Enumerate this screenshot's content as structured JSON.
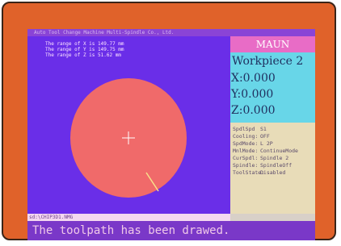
{
  "window": {
    "title": "Auto Tool Change Machine Multi-Spindle Co., Ltd."
  },
  "ranges": [
    "The range of X is 149.77 mm",
    "The range of Y is 149.75 mm",
    "The range of Z is 51.62 mm"
  ],
  "side": {
    "header": "MAUN",
    "workpiece": "Workpiece 2",
    "coords": {
      "x": "X:0.000",
      "y": "Y:0.000",
      "z": "Z:0.000"
    },
    "status": [
      {
        "key": "SpdlSpd",
        "value": "S1"
      },
      {
        "key": "Cooling:",
        "value": "OFF"
      },
      {
        "key": "SpdMode:",
        "value": "L 2P"
      },
      {
        "key": "MnlMode:",
        "value": "ContinueMode"
      },
      {
        "key": "CurSpdl:",
        "value": "Spindle 2"
      },
      {
        "key": "Spindle:",
        "value": "SpindleOff"
      },
      {
        "key": "ToolState:",
        "value": "Disabled"
      }
    ]
  },
  "file_path": "sd:\\CHIP3D1.NMG",
  "message": "The toolpath has been drawed.",
  "colors": {
    "screen_bg": "#6a2ee8",
    "toolpath": "#f06a6a",
    "header_bg": "#e86cc6",
    "coords_bg": "#68d6e8",
    "status_bg": "#e8dcb8",
    "bezel": "#e0622a"
  }
}
